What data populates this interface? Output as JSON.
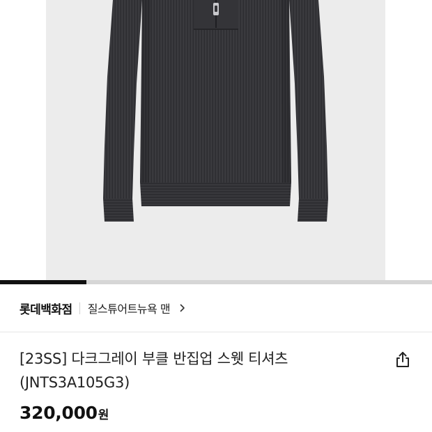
{
  "product_image": {
    "alt": "다크그레이 부클 반집업 스웻 티셔츠"
  },
  "carousel": {
    "progress": 0.2
  },
  "brand": {
    "name": "롯데백화점",
    "store_link": "질스튜어트뉴욕 맨"
  },
  "product": {
    "title_line1": "[23SS] 다크그레이 부클 반집업 스웻 티셔츠",
    "title_line2": "(JNTS3A105G3)",
    "price": "320,000",
    "price_unit": "원"
  },
  "icons": {
    "share": "share-icon",
    "chevron": "chevron-right-icon"
  },
  "colors": {
    "text": "#111111",
    "image_bg": "#ececec",
    "garment": "#3a3a3e",
    "progress_track": "#d6d6d6",
    "progress_fill": "#111111"
  }
}
